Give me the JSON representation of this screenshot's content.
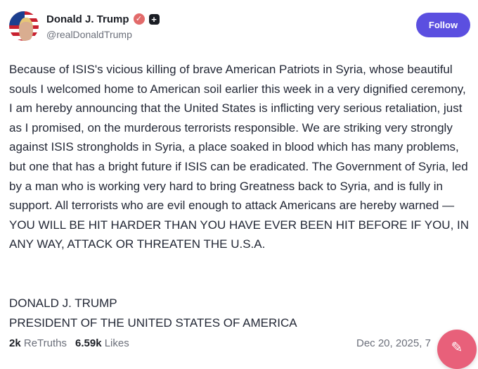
{
  "post": {
    "author": {
      "display_name": "Donald J. Trump",
      "handle": "@realDonaldTrump"
    },
    "follow_label": "Follow",
    "body": "Because of ISIS's vicious killing of brave American Patriots in Syria, whose beautiful souls I welcomed home to American soil earlier this week in a very dignified ceremony, I am hereby announcing that the United States is inflicting very serious retaliation, just as I promised, on the murderous terrorists responsible. We are striking very strongly against ISIS strongholds in Syria, a place soaked in blood which has many problems, but one that has a bright future if ISIS can be eradicated. The Government of Syria, led by a man who is working very hard to bring Greatness back to Syria, and is fully in support. All terrorists who are evil enough to attack Americans are hereby warned — YOU WILL BE HIT HARDER THAN YOU HAVE EVER BEEN HIT BEFORE IF YOU, IN ANY WAY, ATTACK OR THREATEN THE U.S.A.",
    "signature": {
      "line1": "DONALD J. TRUMP",
      "line2": "PRESIDENT OF THE UNITED STATES OF AMERICA"
    },
    "stats": {
      "retruths_count": "2k",
      "retruths_label": "ReTruths",
      "likes_count": "6.59k",
      "likes_label": "Likes"
    },
    "date": "Dec 20, 2025, 7"
  },
  "icons": {
    "verified": "verified-check-icon",
    "badge": "plus-badge-icon",
    "fab": "compose-pencil-icon"
  },
  "colors": {
    "follow_button": "#5b4fe0",
    "verified_badge": "#e26a6a",
    "fab": "#e8607a"
  }
}
